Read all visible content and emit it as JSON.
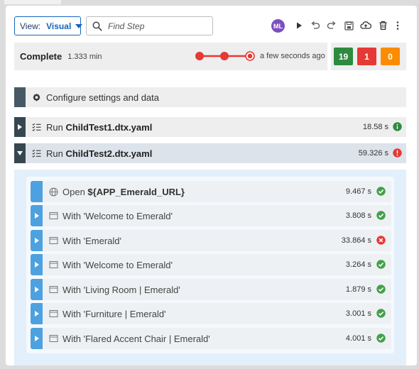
{
  "toolbar": {
    "view_label": "View:",
    "view_value": "Visual",
    "search_placeholder": "Find Step",
    "avatar_initials": "ML",
    "icons": [
      "play-icon",
      "undo-icon",
      "redo-icon",
      "save-icon",
      "cloud-upload-icon",
      "trash-icon",
      "more-vert-icon"
    ]
  },
  "status": {
    "title": "Complete",
    "duration": "1.333 min",
    "ago": "a few seconds ago",
    "colors": {
      "timeline": "#e53935"
    }
  },
  "counts": {
    "passed": "19",
    "failed": "1",
    "warnings": "0",
    "colors": {
      "passed": "#2e8b3e",
      "failed": "#e53935",
      "warnings": "#fb8c00"
    }
  },
  "steps": [
    {
      "prefix": "",
      "label": "Configure settings and data",
      "time": "",
      "icon": "gear-icon",
      "status": ""
    },
    {
      "prefix": "Run ",
      "label": "ChildTest1.dtx.yaml",
      "time": "18.58 s",
      "icon": "checklist-icon",
      "status": "info"
    },
    {
      "prefix": "Run ",
      "label": "ChildTest2.dtx.yaml",
      "time": "59.326 s",
      "icon": "checklist-icon",
      "status": "error",
      "expanded": true
    }
  ],
  "child_steps": [
    {
      "prefix": "Open ",
      "label": "${APP_Emerald_URL}",
      "time": "9.467 s",
      "icon": "globe-icon",
      "status": "pass"
    },
    {
      "prefix": "",
      "label": "With 'Welcome to Emerald'",
      "time": "3.808 s",
      "icon": "window-icon",
      "status": "pass"
    },
    {
      "prefix": "",
      "label": "With 'Emerald'",
      "time": "33.864 s",
      "icon": "window-icon",
      "status": "fail"
    },
    {
      "prefix": "",
      "label": "With 'Welcome to Emerald'",
      "time": "3.264 s",
      "icon": "window-icon",
      "status": "pass"
    },
    {
      "prefix": "",
      "label": "With 'Living Room | Emerald'",
      "time": "1.879 s",
      "icon": "window-icon",
      "status": "pass"
    },
    {
      "prefix": "",
      "label": "With 'Furniture | Emerald'",
      "time": "3.001 s",
      "icon": "window-icon",
      "status": "pass"
    },
    {
      "prefix": "",
      "label": "With 'Flared Accent Chair | Emerald'",
      "time": "4.001 s",
      "icon": "window-icon",
      "status": "pass"
    }
  ]
}
